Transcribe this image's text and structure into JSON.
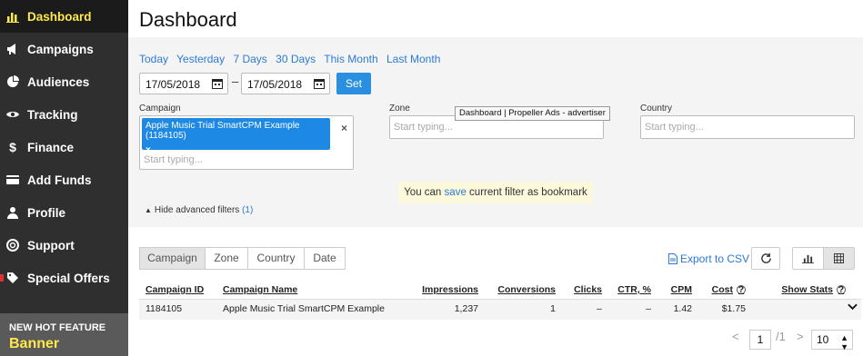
{
  "sidebar": {
    "items": [
      {
        "label": "Dashboard",
        "icon": "bar-chart-icon"
      },
      {
        "label": "Campaigns",
        "icon": "megaphone-icon"
      },
      {
        "label": "Audiences",
        "icon": "pie-chart-icon"
      },
      {
        "label": "Tracking",
        "icon": "eye-icon"
      },
      {
        "label": "Finance",
        "icon": "dollar-icon"
      },
      {
        "label": "Add Funds",
        "icon": "credit-card-icon"
      },
      {
        "label": "Profile",
        "icon": "user-icon"
      },
      {
        "label": "Support",
        "icon": "lifebuoy-icon"
      },
      {
        "label": "Special Offers",
        "icon": "tag-icon"
      }
    ],
    "feature_title": "NEW HOT FEATURE",
    "feature_sub": "Banner"
  },
  "page_title": "Dashboard",
  "quick_dates": [
    "Today",
    "Yesterday",
    "7 Days",
    "30 Days",
    "This Month",
    "Last Month"
  ],
  "date_from": "17/05/2018",
  "date_to": "17/05/2018",
  "date_sep": "–",
  "set_label": "Set",
  "filters": {
    "campaign_label": "Campaign",
    "campaign_chip": "Apple Music Trial SmartCPM Example (1184105)",
    "chip_remove": "×",
    "clear": "×",
    "campaign_placeholder": "Start typing...",
    "zone_label": "Zone",
    "zone_placeholder": "Start typing...",
    "country_label": "Country",
    "country_placeholder": "Start typing..."
  },
  "tooltip": "Dashboard | Propeller Ads - advertiser",
  "bookmark": {
    "pre": "You can",
    "link": "save",
    "post": "current filter as bookmark"
  },
  "advanced": {
    "label": "Hide advanced filters",
    "count": "(1)"
  },
  "tabs": [
    "Campaign",
    "Zone",
    "Country",
    "Date"
  ],
  "export_label": "Export to CSV",
  "table": {
    "headers": {
      "id": "Campaign ID",
      "name": "Campaign Name",
      "impressions": "Impressions",
      "conversions": "Conversions",
      "clicks": "Clicks",
      "ctr": "CTR, %",
      "cpm": "CPM",
      "cost": "Cost",
      "show_stats": "Show Stats"
    },
    "rows": [
      {
        "id": "1184105",
        "name": "Apple Music Trial SmartCPM Example",
        "impressions": "1,237",
        "conversions": "1",
        "clicks": "–",
        "ctr": "–",
        "cpm": "1.42",
        "cost": "$1.75"
      }
    ]
  },
  "pagination": {
    "prev": "<",
    "page": "1",
    "total": "/1",
    "next": ">",
    "per_page": "10"
  },
  "colors": {
    "accent": "#2b8fe0",
    "active_nav": "#ffe94a",
    "sidebar": "#2f2f2f"
  }
}
